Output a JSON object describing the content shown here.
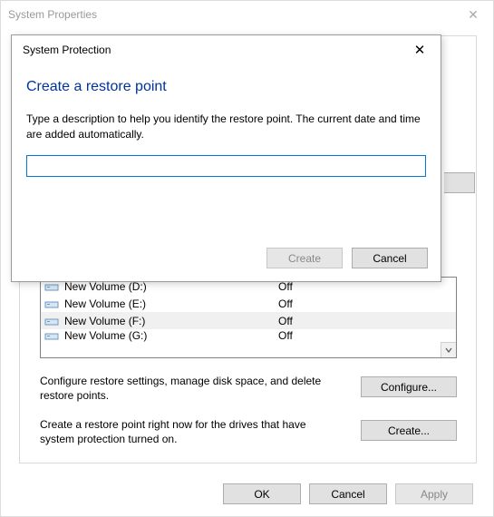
{
  "parent": {
    "title": "System Properties"
  },
  "drives": [
    {
      "name": "New Volume (D:)",
      "status": "Off",
      "selected": false
    },
    {
      "name": "New Volume (E:)",
      "status": "Off",
      "selected": false
    },
    {
      "name": "New Volume (F:)",
      "status": "Off",
      "selected": true
    },
    {
      "name": "New Volume (G:)",
      "status": "Off",
      "selected": false
    }
  ],
  "configure": {
    "text": "Configure restore settings, manage disk space, and delete restore points.",
    "button": "Configure..."
  },
  "create_section": {
    "text": "Create a restore point right now for the drives that have system protection turned on.",
    "button": "Create..."
  },
  "bottom": {
    "ok": "OK",
    "cancel": "Cancel",
    "apply": "Apply"
  },
  "dialog": {
    "title": "System Protection",
    "heading": "Create a restore point",
    "description": "Type a description to help you identify the restore point. The current date and time are added automatically.",
    "input_value": "",
    "create": "Create",
    "cancel": "Cancel"
  }
}
